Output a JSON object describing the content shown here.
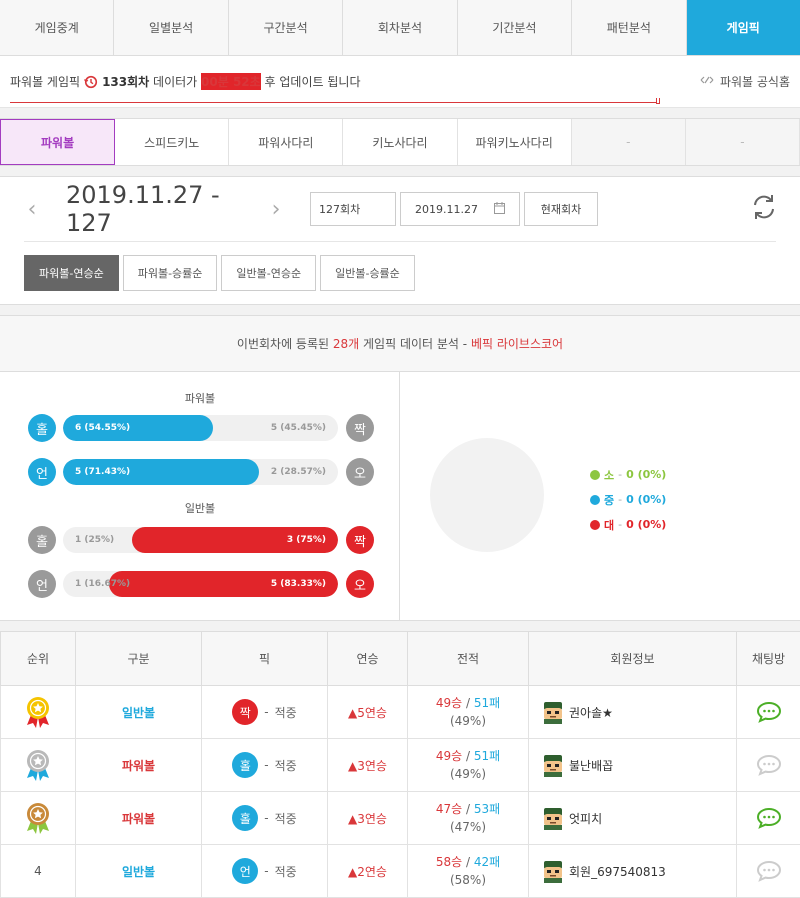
{
  "tabs": [
    "게임중계",
    "일별분석",
    "구간분석",
    "회차분석",
    "기간분석",
    "패턴분석",
    "게임픽"
  ],
  "notice": {
    "prefix": "파워볼 게임픽",
    "round": "133회차",
    "mid": "데이터가",
    "time": "00분 52초",
    "suffix": "후 업데이트 됩니다",
    "official": "파워볼 공식홈"
  },
  "games": [
    "파워볼",
    "스피드키노",
    "파워사다리",
    "키노사다리",
    "파워키노사다리",
    "-",
    "-"
  ],
  "control": {
    "date": "2019.11.27 - 127",
    "round_box": "127회차",
    "date_box": "2019.11.27",
    "current_btn": "현재회차",
    "sort": [
      "파워볼-연승순",
      "파워볼-승률순",
      "일반볼-연승순",
      "일반볼-승률순"
    ]
  },
  "analysis": {
    "head_pre": "이번회차에 등록된",
    "head_count": "28개",
    "head_mid": "게임픽 데이터 분석 -",
    "head_brand": "베픽 라이브스코어",
    "powerball_title": "파워볼",
    "normal_title": "일반볼",
    "rows": [
      {
        "left": "홀",
        "right": "짝",
        "left_text": "6 (54.55%)",
        "right_text": "5 (45.45%)",
        "fill_side": "left",
        "fill_pct": 54.55,
        "color": "blue"
      },
      {
        "left": "언",
        "right": "오",
        "left_text": "5 (71.43%)",
        "right_text": "2 (28.57%)",
        "fill_side": "left",
        "fill_pct": 71.43,
        "color": "blue"
      },
      {
        "left": "홀",
        "right": "짝",
        "left_text": "1 (25%)",
        "right_text": "3 (75%)",
        "fill_side": "right",
        "fill_pct": 75,
        "color": "red"
      },
      {
        "left": "언",
        "right": "오",
        "left_text": "1 (16.67%)",
        "right_text": "5 (83.33%)",
        "fill_side": "right",
        "fill_pct": 83.33,
        "color": "red"
      }
    ],
    "legend": [
      {
        "label": "소",
        "value": "0 (0%)",
        "color": "#8cc63f"
      },
      {
        "label": "중",
        "value": "0 (0%)",
        "color": "#1fa9dc"
      },
      {
        "label": "대",
        "value": "0 (0%)",
        "color": "#e1252a"
      }
    ]
  },
  "table": {
    "headers": [
      "순위",
      "구분",
      "픽",
      "연승",
      "전적",
      "회원정보",
      "채팅방"
    ],
    "rows": [
      {
        "rank": "1",
        "medal": "gold",
        "cat": "일반볼",
        "cat_color": "b",
        "pick": "짝",
        "pick_color": "red",
        "pick_result": "적중",
        "streak": "▲5연승",
        "wins": "49승",
        "losses": "51패",
        "pct": "(49%)",
        "member": "권아솔★",
        "chat": "active"
      },
      {
        "rank": "2",
        "medal": "silver",
        "cat": "파워볼",
        "cat_color": "r",
        "pick": "홀",
        "pick_color": "blue",
        "pick_result": "적중",
        "streak": "▲3연승",
        "wins": "49승",
        "losses": "51패",
        "pct": "(49%)",
        "member": "불난배꼽",
        "chat": "inactive"
      },
      {
        "rank": "3",
        "medal": "bronze",
        "cat": "파워볼",
        "cat_color": "r",
        "pick": "홀",
        "pick_color": "blue",
        "pick_result": "적중",
        "streak": "▲3연승",
        "wins": "47승",
        "losses": "53패",
        "pct": "(47%)",
        "member": "엇피치",
        "chat": "active"
      },
      {
        "rank": "4",
        "medal": "",
        "cat": "일반볼",
        "cat_color": "b",
        "pick": "언",
        "pick_color": "blue",
        "pick_result": "적중",
        "streak": "▲2연승",
        "wins": "58승",
        "losses": "42패",
        "pct": "(58%)",
        "member": "회원_697540813",
        "chat": "inactive"
      }
    ]
  }
}
